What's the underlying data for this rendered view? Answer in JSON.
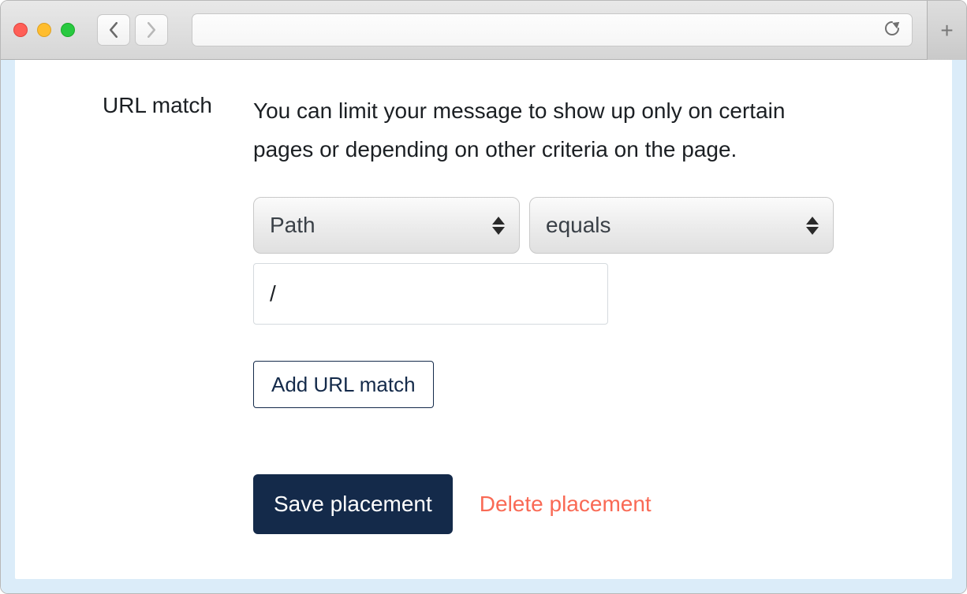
{
  "form": {
    "section_label": "URL match",
    "help_text": "You can limit your message to show up only on certain pages or depending on other criteria on the page.",
    "field_select_value": "Path",
    "operator_select_value": "equals",
    "value_input": "/",
    "add_button_label": "Add URL match",
    "save_button_label": "Save placement",
    "delete_link_label": "Delete placement"
  }
}
